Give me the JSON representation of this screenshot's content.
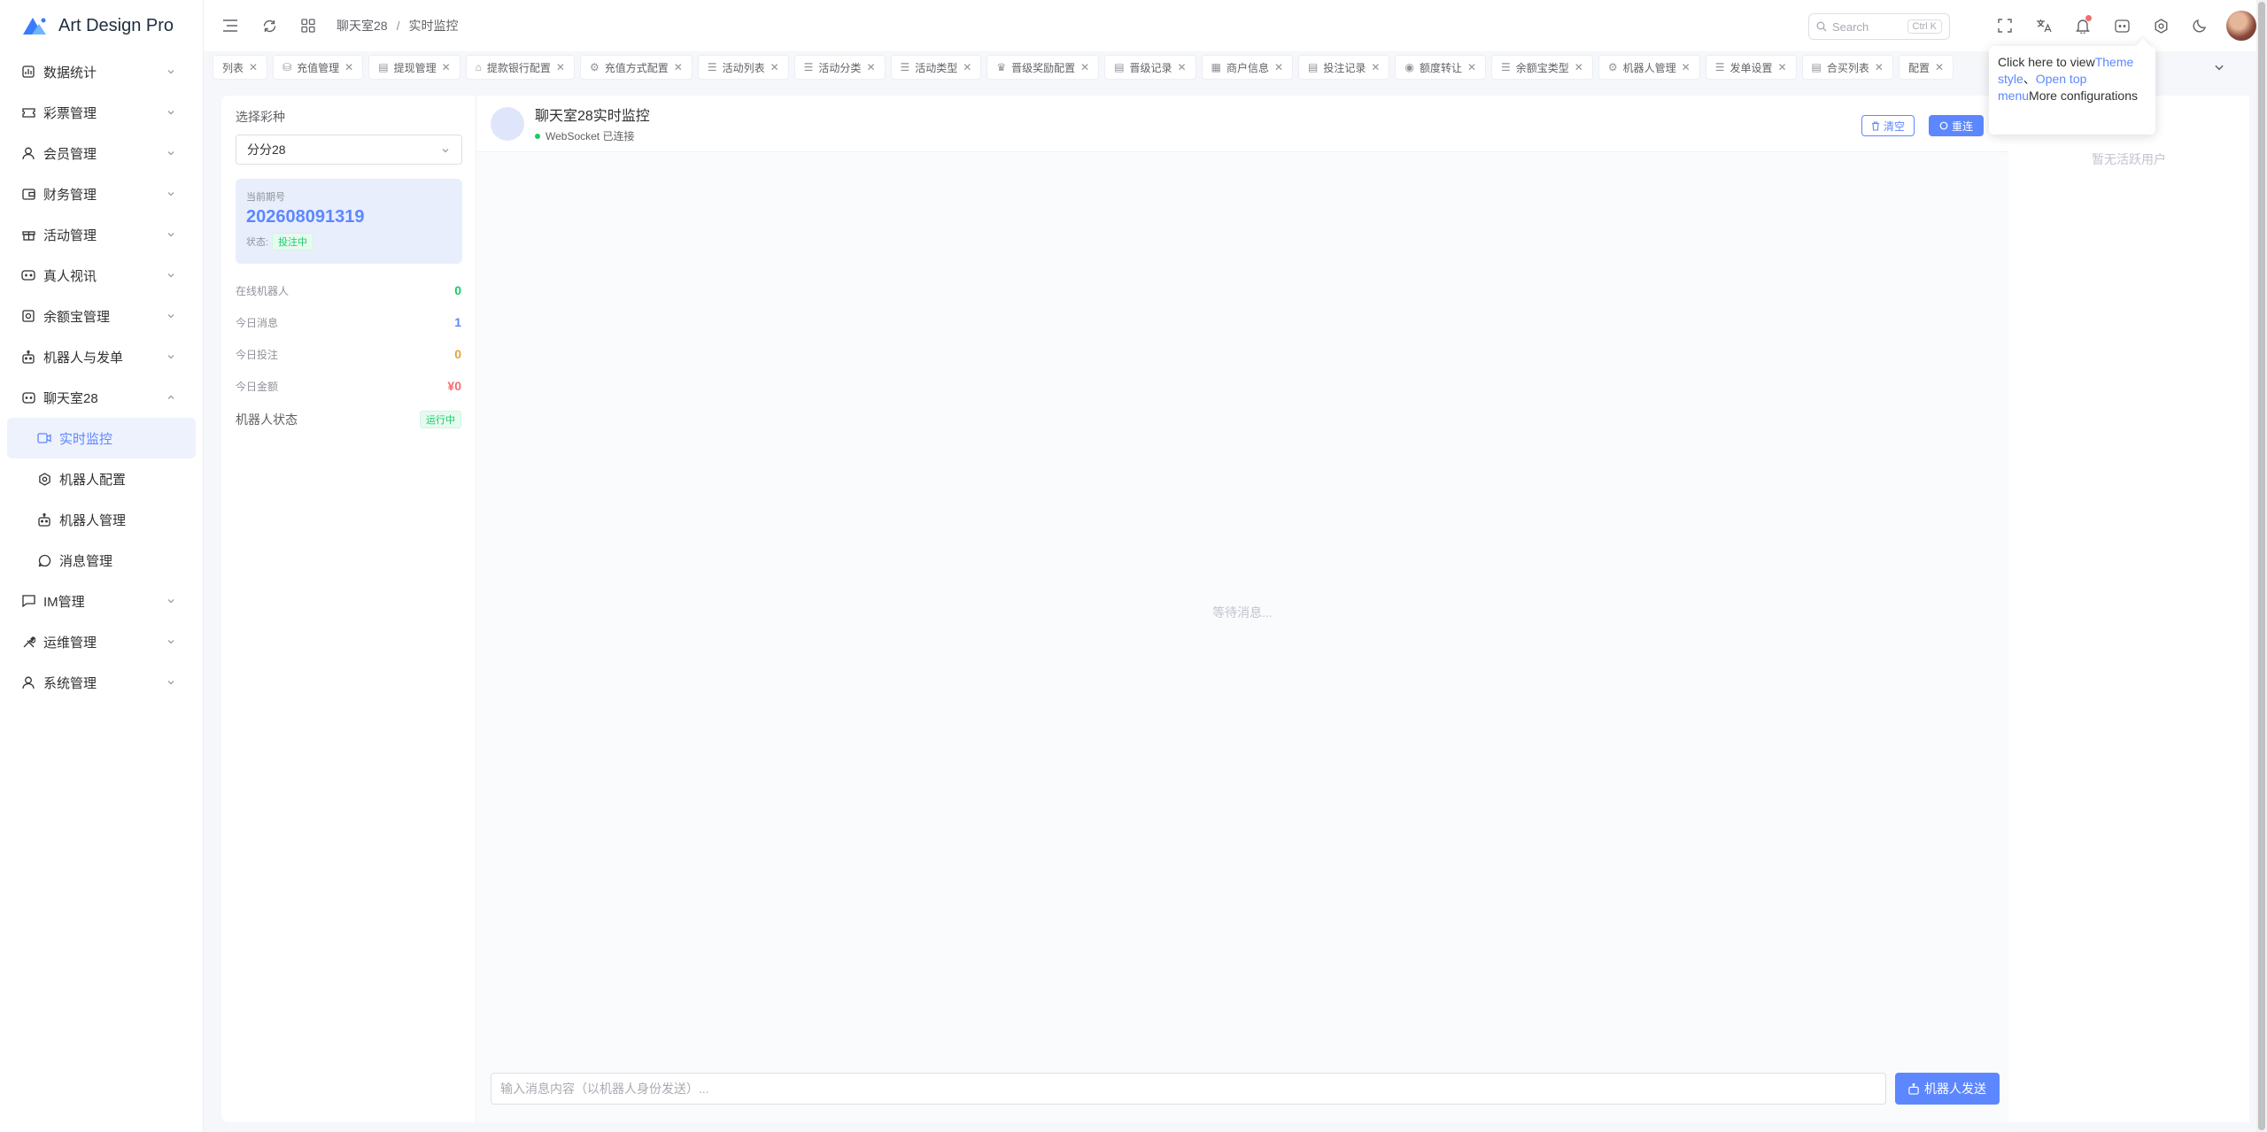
{
  "app": {
    "title": "Art Design Pro"
  },
  "sidebar": {
    "items": [
      {
        "label": "数据统计",
        "icon": "bar-chart-icon"
      },
      {
        "label": "彩票管理",
        "icon": "ticket-icon"
      },
      {
        "label": "会员管理",
        "icon": "user-icon"
      },
      {
        "label": "财务管理",
        "icon": "wallet-icon"
      },
      {
        "label": "活动管理",
        "icon": "gift-icon"
      },
      {
        "label": "真人视讯",
        "icon": "gamepad-icon"
      },
      {
        "label": "余额宝管理",
        "icon": "safe-icon"
      },
      {
        "label": "机器人与发单",
        "icon": "robot-icon"
      },
      {
        "label": "聊天室28",
        "icon": "chat-icon"
      }
    ],
    "subitems": [
      {
        "label": "实时监控",
        "icon": "video-icon"
      },
      {
        "label": "机器人配置",
        "icon": "gear-icon"
      },
      {
        "label": "机器人管理",
        "icon": "robot-icon"
      },
      {
        "label": "消息管理",
        "icon": "message-icon"
      }
    ],
    "bottom_items": [
      {
        "label": "IM管理",
        "icon": "chat-bubble-icon"
      },
      {
        "label": "运维管理",
        "icon": "tools-icon"
      },
      {
        "label": "系统管理",
        "icon": "user-icon"
      }
    ]
  },
  "topbar": {
    "breadcrumb": [
      "聊天室28",
      "实时监控"
    ],
    "breadcrumb_sep": "/",
    "search_placeholder": "Search",
    "search_shortcut": "Ctrl K"
  },
  "tabs": [
    {
      "label": "列表",
      "icon": ""
    },
    {
      "label": "充值管理",
      "icon": "⛁"
    },
    {
      "label": "提现管理",
      "icon": "▤"
    },
    {
      "label": "提款银行配置",
      "icon": "⌂"
    },
    {
      "label": "充值方式配置",
      "icon": "⚙"
    },
    {
      "label": "活动列表",
      "icon": "☰"
    },
    {
      "label": "活动分类",
      "icon": "☰"
    },
    {
      "label": "活动类型",
      "icon": "☰"
    },
    {
      "label": "晋级奖励配置",
      "icon": "♛"
    },
    {
      "label": "晋级记录",
      "icon": "▤"
    },
    {
      "label": "商户信息",
      "icon": "▦"
    },
    {
      "label": "投注记录",
      "icon": "▤"
    },
    {
      "label": "额度转让",
      "icon": "◉"
    },
    {
      "label": "余额宝类型",
      "icon": "☰"
    },
    {
      "label": "机器人管理",
      "icon": "⚙"
    },
    {
      "label": "发单设置",
      "icon": "☰"
    },
    {
      "label": "合买列表",
      "icon": "▤"
    },
    {
      "label": "配置",
      "icon": ""
    }
  ],
  "left_panel": {
    "select_label": "选择彩种",
    "select_value": "分分28",
    "period_label": "当前期号",
    "period_number": "202608091319",
    "status_label": "状态:",
    "status_value": "投注中",
    "stats": [
      {
        "label": "在线机器人",
        "value": "0",
        "color": "#13ce66"
      },
      {
        "label": "今日消息",
        "value": "1",
        "color": "#5d87ff"
      },
      {
        "label": "今日投注",
        "value": "0",
        "color": "#e6a23c"
      },
      {
        "label": "今日金额",
        "value": "¥0",
        "color": "#f56c6c"
      }
    ],
    "robot_status_label": "机器人状态",
    "robot_status_value": "运行中"
  },
  "chat": {
    "title": "聊天室28实时监控",
    "ws_status": "WebSocket 已连接",
    "clear_label": "清空",
    "reconnect_label": "重连",
    "waiting_text": "等待消息...",
    "input_placeholder": "输入消息内容（以机器人身份发送）...",
    "input_value": "",
    "send_label": "机器人发送"
  },
  "right_panel": {
    "empty_text": "暂无活跃用户"
  },
  "tooltip": {
    "p1": "Click here to view",
    "h1": "Theme style",
    "p2": "、",
    "h2": "Open top menu",
    "p3": "More configurations"
  },
  "colors": {
    "primary": "#5d87ff",
    "success": "#13ce66",
    "warning": "#e6a23c",
    "danger": "#f56c6c"
  }
}
